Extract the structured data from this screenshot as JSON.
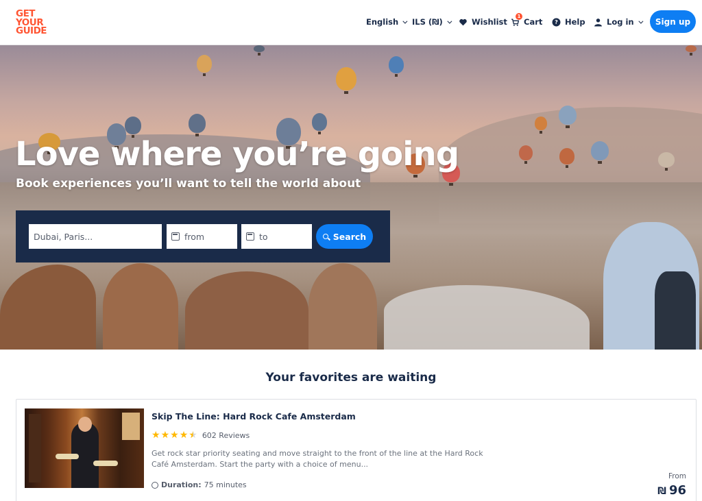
{
  "header": {
    "logo_lines": [
      "GET",
      "YOUR",
      "GUIDE"
    ],
    "nav": {
      "language": "English",
      "currency": "ILS (₪)",
      "wishlist": "Wishlist",
      "cart": "Cart",
      "cart_count": "1",
      "help": "Help",
      "login": "Log in"
    },
    "signup_label": "Sign up"
  },
  "hero": {
    "title": "Love where you’re going",
    "subtitle": "Book experiences you’ll want to tell the world about",
    "search": {
      "destination_placeholder": "Dubai, Paris...",
      "from_placeholder": "from",
      "to_placeholder": "to",
      "button_label": "Search"
    }
  },
  "favorites": {
    "title": "Your favorites are waiting",
    "card": {
      "title": "Skip The Line: Hard Rock Cafe Amsterdam",
      "rating": 4.5,
      "reviews": "602 Reviews",
      "description": "Get rock star priority seating and move straight to the front of the line at the Hard Rock Café Amsterdam. Start the party with a choice of menu...",
      "duration_label": "Duration:",
      "duration_value": "75 minutes",
      "price_prefix": "From",
      "currency_symbol": "₪",
      "price": "96"
    }
  },
  "colors": {
    "brand_orange": "#ff5533",
    "primary_blue": "#0e7ef3",
    "navy": "#1a2b49",
    "star": "#ffb800"
  }
}
